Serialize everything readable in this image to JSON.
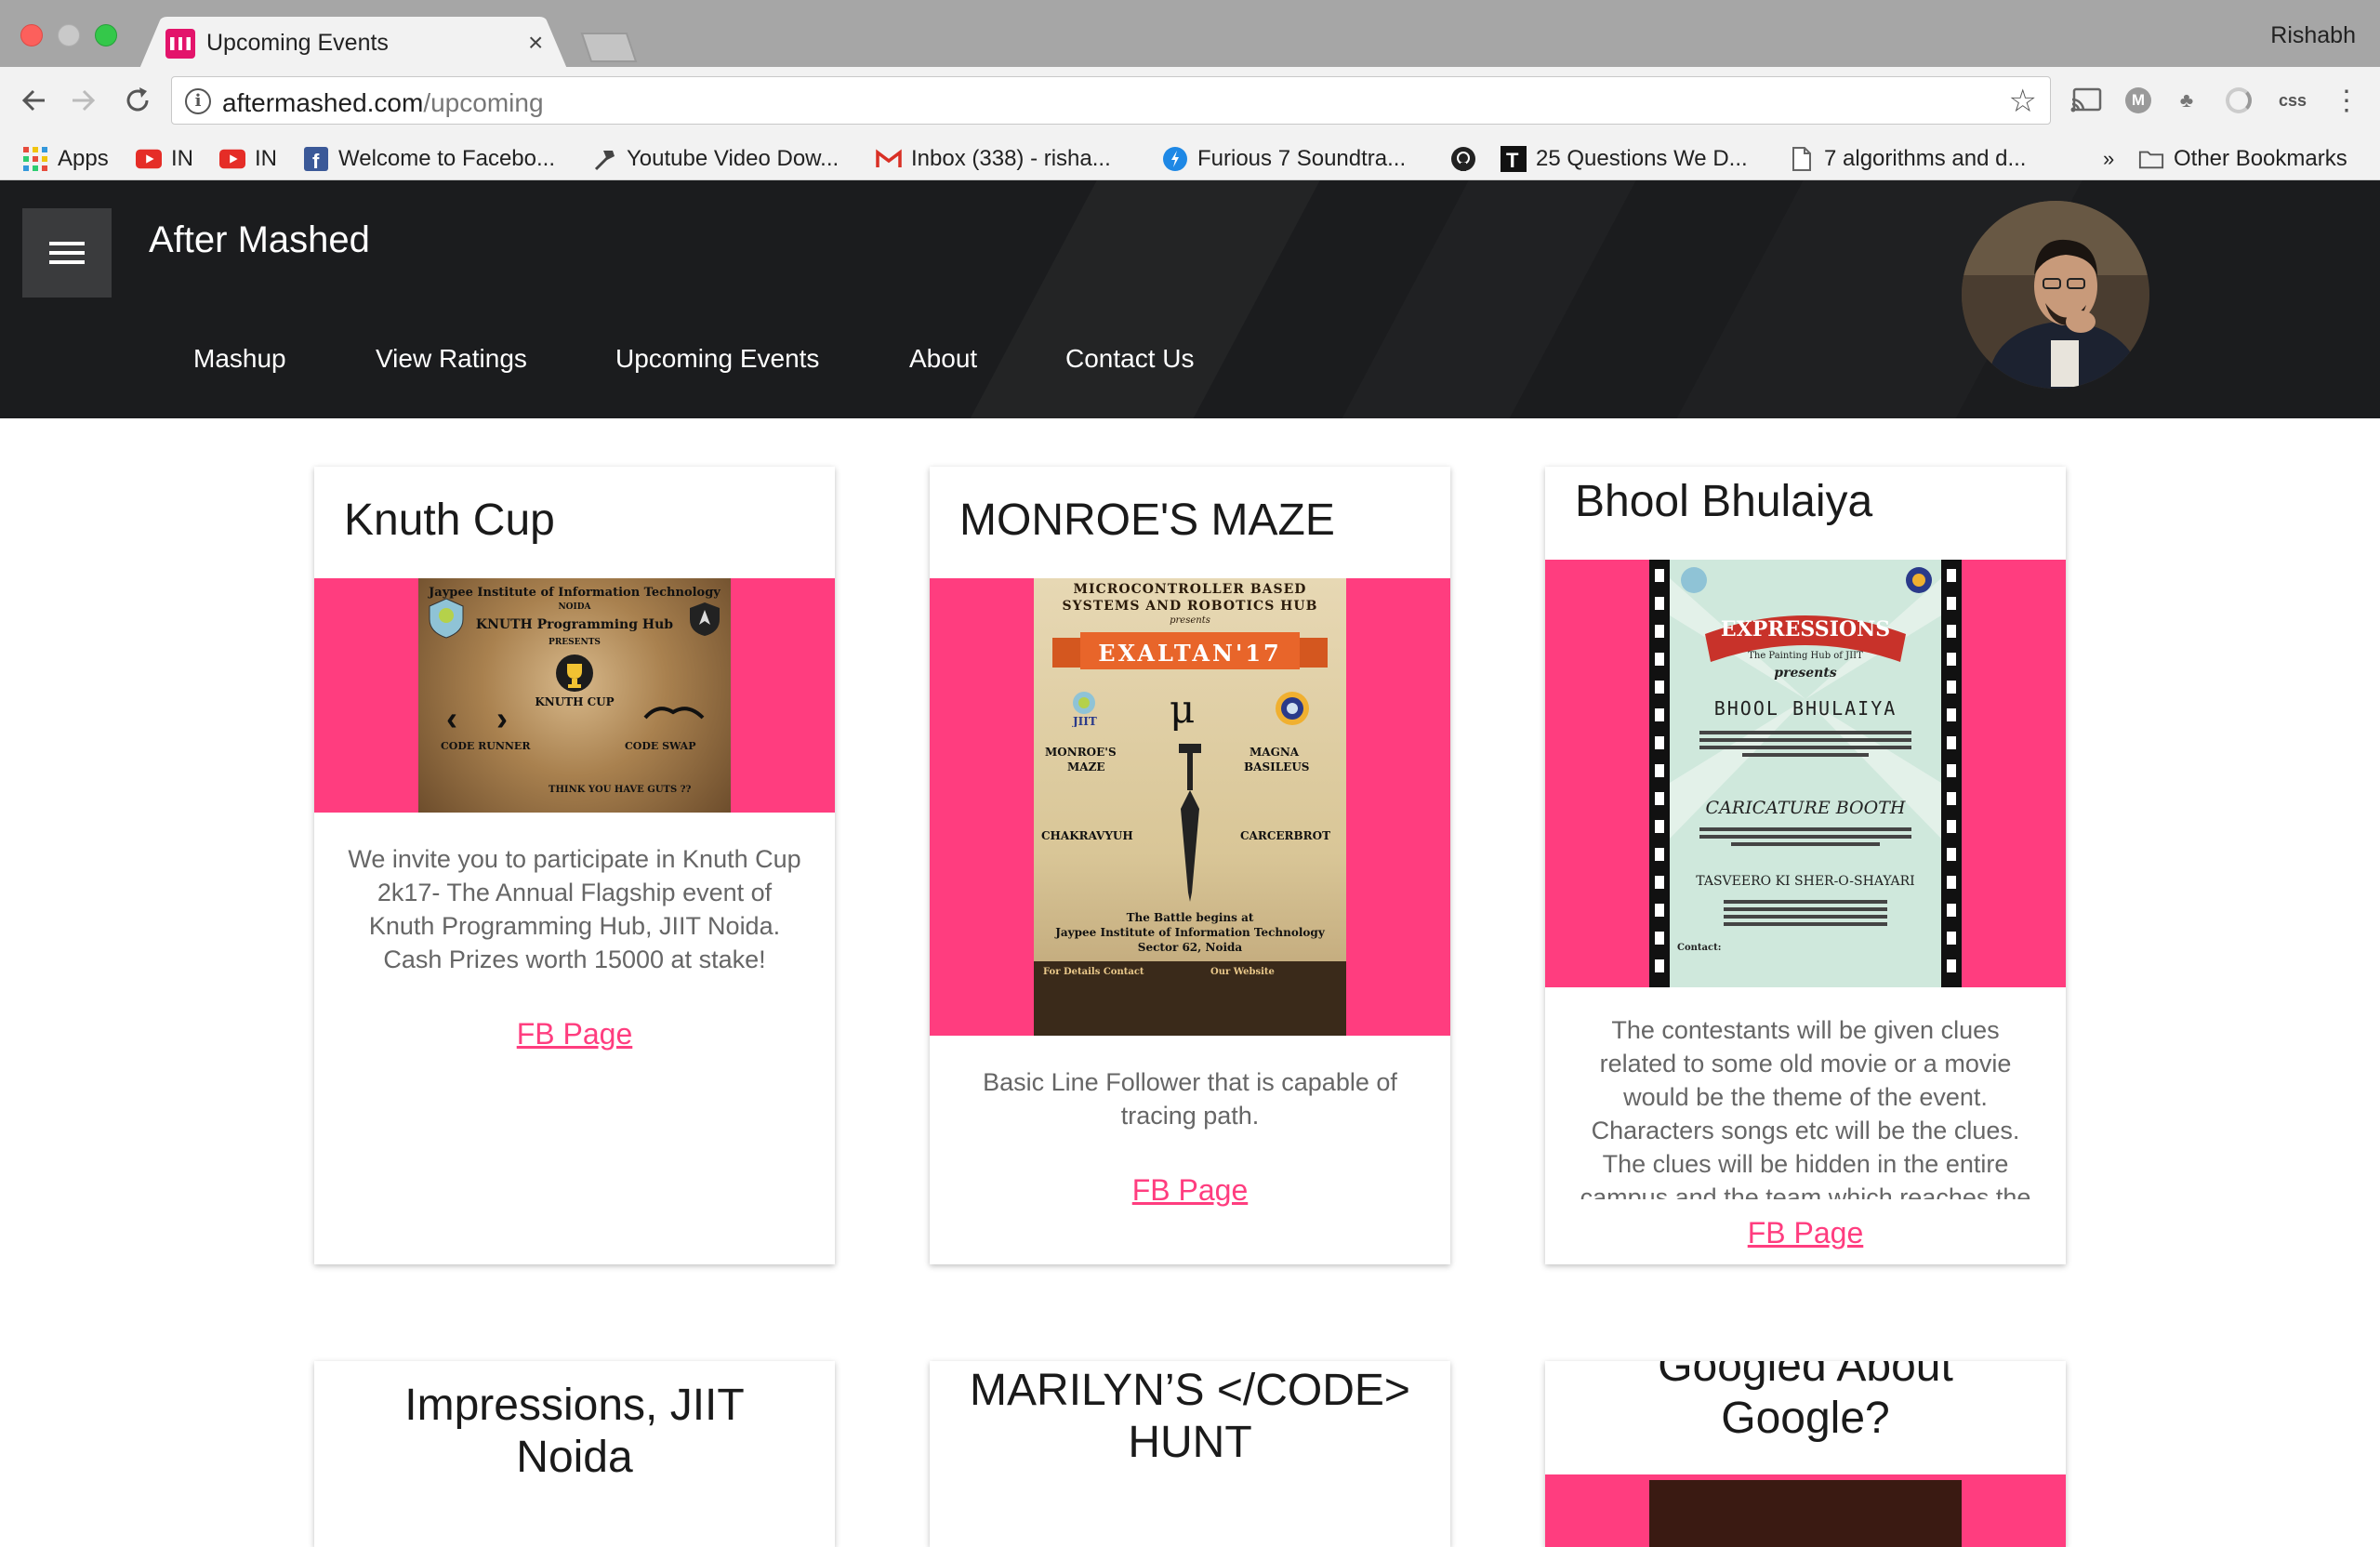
{
  "browser": {
    "tab_title": "Upcoming Events",
    "profile_name": "Rishabh",
    "url_host": "aftermashed.com",
    "url_path": "/upcoming",
    "extensions": [
      "cast-icon",
      "m-icon",
      "tree-icon",
      "circle-icon",
      "css"
    ],
    "bookmarks": [
      {
        "label": "Apps",
        "icon": "apps-grid-icon"
      },
      {
        "label": "IN",
        "icon": "youtube-icon"
      },
      {
        "label": "IN",
        "icon": "youtube-icon"
      },
      {
        "label": "Welcome to Facebo...",
        "icon": "facebook-icon"
      },
      {
        "label": "Youtube Video Dow...",
        "icon": "hammer-icon"
      },
      {
        "label": "Inbox (338) - risha...",
        "icon": "gmail-icon"
      },
      {
        "label": "Furious 7 Soundtra...",
        "icon": "shazam-icon"
      },
      {
        "label": "",
        "icon": "github-icon"
      },
      {
        "label": "25 Questions We D...",
        "icon": "t-icon"
      },
      {
        "label": "7 algorithms and d...",
        "icon": "page-icon"
      }
    ],
    "overflow_label": "»",
    "other_bookmarks": "Other Bookmarks"
  },
  "site": {
    "brand": "After Mashed",
    "nav": [
      "Mashup",
      "View Ratings",
      "Upcoming Events",
      "About",
      "Contact Us"
    ]
  },
  "cards": [
    {
      "title": "Knuth Cup",
      "description": "We invite you to participate in Knuth Cup 2k17- The Annual Flagship event of Knuth Programming Hub, JIIT Noida. Cash Prizes worth 15000 at stake!",
      "link": "FB Page",
      "poster": {
        "line1": "Jaypee Institute of Information Technology",
        "line2": "NOIDA",
        "line3": "KNUTH Programming Hub",
        "line4": "PRESENTS",
        "line5": "KNUTH CUP",
        "left": "CODE RUNNER",
        "right": "CODE SWAP",
        "footer": "THINK YOU HAVE GUTS ??"
      }
    },
    {
      "title": "MONROE'S MAZE",
      "description": "Basic Line Follower that is capable of tracing path.",
      "link": "FB Page",
      "poster": {
        "line1": "MICROCONTROLLER BASED",
        "line2": "SYSTEMS AND ROBOTICS HUB",
        "line3": "presents",
        "banner": "EXALTAN'17",
        "left1": "MONROE'S",
        "left1b": "MAZE",
        "right1": "MAGNA",
        "right1b": "BASILEUS",
        "left2": "CHAKRAVYUH",
        "right2": "CARCERBROT",
        "bottom1": "The Battle begins at",
        "bottom2": "Jaypee Institute of Information Technology",
        "bottom3": "Sector 62, Noida",
        "contact": "For Details Contact",
        "website": "Our Website"
      }
    },
    {
      "title": "Bhool Bhulaiya",
      "description": "The contestants will be given clues related to some old movie or a movie would be the theme of the event. Characters songs etc will be the clues. The clues will be hidden in the entire campus and the team which reaches the",
      "link": "FB Page",
      "poster": {
        "banner": "EXPRESSIONS",
        "sub": "The Painting Hub of JIIT",
        "presents": "presents",
        "line1": "BHOOL BHULAIYA",
        "line2": "CARICATURE BOOTH",
        "line3": "TASVEERO KI SHER-O-SHAYARI",
        "contact": "Contact:"
      }
    },
    {
      "title": "Impressions, JIIT Noida"
    },
    {
      "title": "MARILYN’S </CODE> HUNT"
    },
    {
      "title": "Googled About Google?"
    }
  ]
}
